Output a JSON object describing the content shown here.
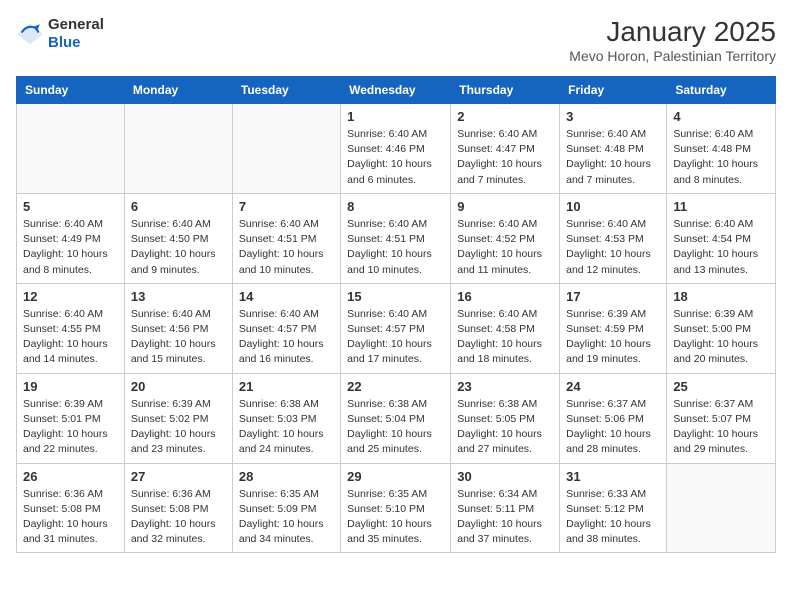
{
  "logo": {
    "general": "General",
    "blue": "Blue"
  },
  "title": "January 2025",
  "subtitle": "Mevo Horon, Palestinian Territory",
  "headers": [
    "Sunday",
    "Monday",
    "Tuesday",
    "Wednesday",
    "Thursday",
    "Friday",
    "Saturday"
  ],
  "weeks": [
    [
      {
        "day": "",
        "info": ""
      },
      {
        "day": "",
        "info": ""
      },
      {
        "day": "",
        "info": ""
      },
      {
        "day": "1",
        "info": "Sunrise: 6:40 AM\nSunset: 4:46 PM\nDaylight: 10 hours and 6 minutes."
      },
      {
        "day": "2",
        "info": "Sunrise: 6:40 AM\nSunset: 4:47 PM\nDaylight: 10 hours and 7 minutes."
      },
      {
        "day": "3",
        "info": "Sunrise: 6:40 AM\nSunset: 4:48 PM\nDaylight: 10 hours and 7 minutes."
      },
      {
        "day": "4",
        "info": "Sunrise: 6:40 AM\nSunset: 4:48 PM\nDaylight: 10 hours and 8 minutes."
      }
    ],
    [
      {
        "day": "5",
        "info": "Sunrise: 6:40 AM\nSunset: 4:49 PM\nDaylight: 10 hours and 8 minutes."
      },
      {
        "day": "6",
        "info": "Sunrise: 6:40 AM\nSunset: 4:50 PM\nDaylight: 10 hours and 9 minutes."
      },
      {
        "day": "7",
        "info": "Sunrise: 6:40 AM\nSunset: 4:51 PM\nDaylight: 10 hours and 10 minutes."
      },
      {
        "day": "8",
        "info": "Sunrise: 6:40 AM\nSunset: 4:51 PM\nDaylight: 10 hours and 10 minutes."
      },
      {
        "day": "9",
        "info": "Sunrise: 6:40 AM\nSunset: 4:52 PM\nDaylight: 10 hours and 11 minutes."
      },
      {
        "day": "10",
        "info": "Sunrise: 6:40 AM\nSunset: 4:53 PM\nDaylight: 10 hours and 12 minutes."
      },
      {
        "day": "11",
        "info": "Sunrise: 6:40 AM\nSunset: 4:54 PM\nDaylight: 10 hours and 13 minutes."
      }
    ],
    [
      {
        "day": "12",
        "info": "Sunrise: 6:40 AM\nSunset: 4:55 PM\nDaylight: 10 hours and 14 minutes."
      },
      {
        "day": "13",
        "info": "Sunrise: 6:40 AM\nSunset: 4:56 PM\nDaylight: 10 hours and 15 minutes."
      },
      {
        "day": "14",
        "info": "Sunrise: 6:40 AM\nSunset: 4:57 PM\nDaylight: 10 hours and 16 minutes."
      },
      {
        "day": "15",
        "info": "Sunrise: 6:40 AM\nSunset: 4:57 PM\nDaylight: 10 hours and 17 minutes."
      },
      {
        "day": "16",
        "info": "Sunrise: 6:40 AM\nSunset: 4:58 PM\nDaylight: 10 hours and 18 minutes."
      },
      {
        "day": "17",
        "info": "Sunrise: 6:39 AM\nSunset: 4:59 PM\nDaylight: 10 hours and 19 minutes."
      },
      {
        "day": "18",
        "info": "Sunrise: 6:39 AM\nSunset: 5:00 PM\nDaylight: 10 hours and 20 minutes."
      }
    ],
    [
      {
        "day": "19",
        "info": "Sunrise: 6:39 AM\nSunset: 5:01 PM\nDaylight: 10 hours and 22 minutes."
      },
      {
        "day": "20",
        "info": "Sunrise: 6:39 AM\nSunset: 5:02 PM\nDaylight: 10 hours and 23 minutes."
      },
      {
        "day": "21",
        "info": "Sunrise: 6:38 AM\nSunset: 5:03 PM\nDaylight: 10 hours and 24 minutes."
      },
      {
        "day": "22",
        "info": "Sunrise: 6:38 AM\nSunset: 5:04 PM\nDaylight: 10 hours and 25 minutes."
      },
      {
        "day": "23",
        "info": "Sunrise: 6:38 AM\nSunset: 5:05 PM\nDaylight: 10 hours and 27 minutes."
      },
      {
        "day": "24",
        "info": "Sunrise: 6:37 AM\nSunset: 5:06 PM\nDaylight: 10 hours and 28 minutes."
      },
      {
        "day": "25",
        "info": "Sunrise: 6:37 AM\nSunset: 5:07 PM\nDaylight: 10 hours and 29 minutes."
      }
    ],
    [
      {
        "day": "26",
        "info": "Sunrise: 6:36 AM\nSunset: 5:08 PM\nDaylight: 10 hours and 31 minutes."
      },
      {
        "day": "27",
        "info": "Sunrise: 6:36 AM\nSunset: 5:08 PM\nDaylight: 10 hours and 32 minutes."
      },
      {
        "day": "28",
        "info": "Sunrise: 6:35 AM\nSunset: 5:09 PM\nDaylight: 10 hours and 34 minutes."
      },
      {
        "day": "29",
        "info": "Sunrise: 6:35 AM\nSunset: 5:10 PM\nDaylight: 10 hours and 35 minutes."
      },
      {
        "day": "30",
        "info": "Sunrise: 6:34 AM\nSunset: 5:11 PM\nDaylight: 10 hours and 37 minutes."
      },
      {
        "day": "31",
        "info": "Sunrise: 6:33 AM\nSunset: 5:12 PM\nDaylight: 10 hours and 38 minutes."
      },
      {
        "day": "",
        "info": ""
      }
    ]
  ]
}
